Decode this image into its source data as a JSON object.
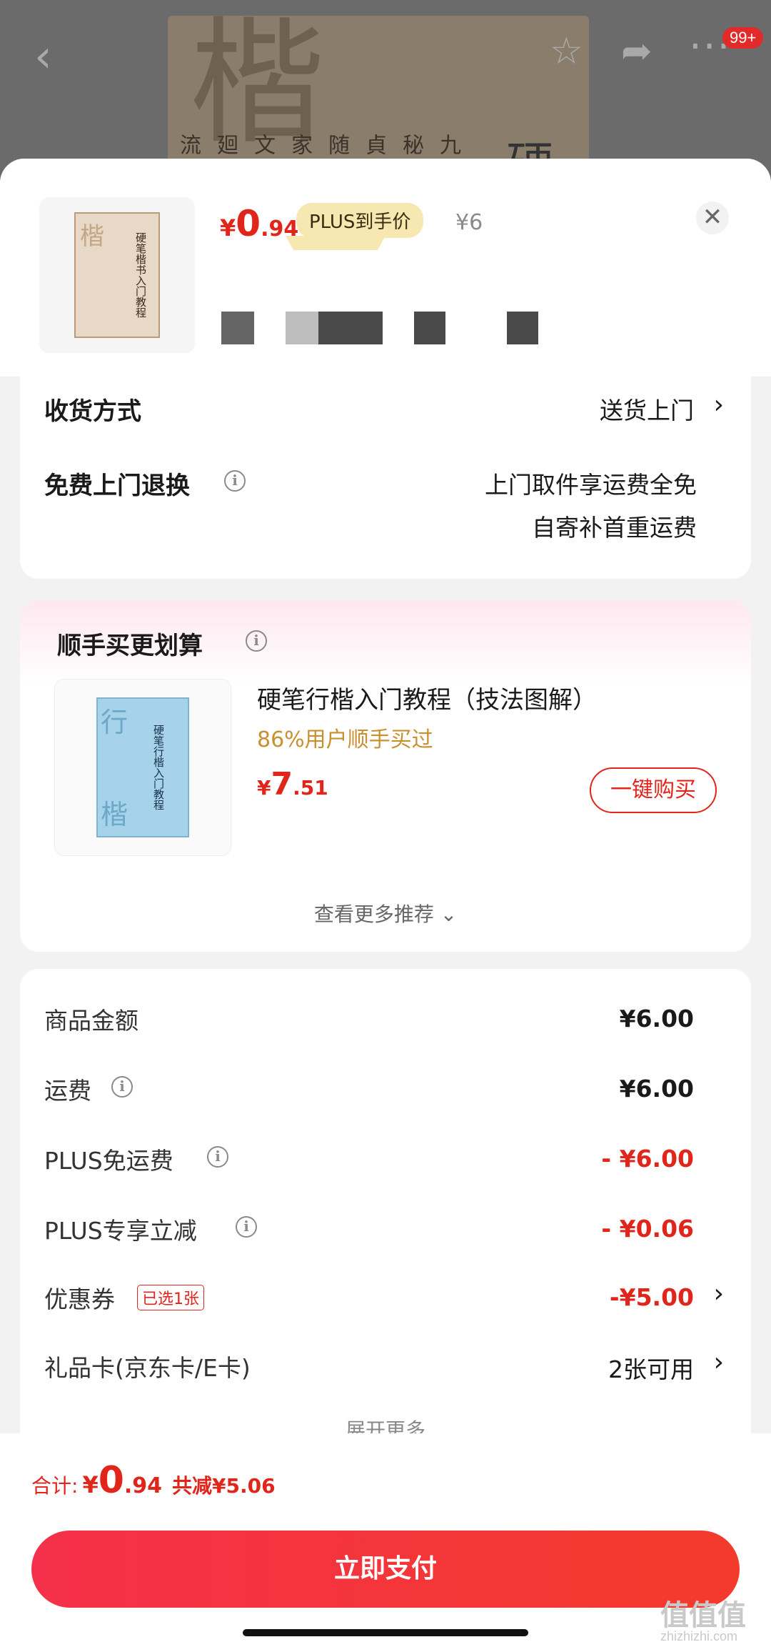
{
  "background": {
    "cover_big_char": "楷",
    "cover_side_char": "硬",
    "cover_columns": [
      "九",
      "秘",
      "貞",
      "随",
      "家",
      "文",
      "廻",
      "流"
    ],
    "badge": "99+"
  },
  "product": {
    "price_yen": "¥",
    "price_int": "0",
    "price_dec": ".94",
    "plus_tag": "PLUS到手价",
    "original_price": "¥6",
    "thumb_char": "楷",
    "thumb_title": "硬笔楷书入门教程",
    "close": "✕"
  },
  "delivery": {
    "method_label": "收货方式",
    "method_value": "送货上门",
    "return_label": "免费上门退换",
    "return_line1": "上门取件享运费全免",
    "return_line2": "自寄补首重运费"
  },
  "recommend": {
    "title": "顺手买更划算",
    "item_name": "硬笔行楷入门教程（技法图解）",
    "item_sub": "86%用户顺手买过",
    "price_yen": "¥",
    "price_int": "7",
    "price_dec": ".51",
    "buy_label": "一键购买",
    "more_label": "查看更多推荐 ⌄",
    "book_char1": "行",
    "book_char2": "楷",
    "book_title": "硬笔行楷入门教程"
  },
  "summary": {
    "rows": [
      {
        "label": "商品金额",
        "value": "¥6.00"
      },
      {
        "label": "运费",
        "value": "¥6.00"
      },
      {
        "label": "PLUS免运费",
        "value": "- ¥6.00"
      },
      {
        "label": "PLUS专享立减",
        "value": "- ¥0.06"
      },
      {
        "label": "优惠券",
        "value": "-¥5.00",
        "tag": "已选1张"
      },
      {
        "label": "礼品卡(京东卡/E卡)",
        "value": "2张可用"
      }
    ],
    "expand_label": "展开更多"
  },
  "bottom": {
    "total_label": "合计:",
    "total_yen": "¥",
    "total_int": "0",
    "total_dec": ".94",
    "saved": "共减¥5.06",
    "pay_label": "立即支付",
    "watermark": "值值值",
    "watermark_sub": "zhizhizhi.com"
  },
  "colors": {
    "accent": "#e1251b",
    "plus_gold": "#f7e7b1",
    "pay_gradient_start": "#f5304a"
  }
}
